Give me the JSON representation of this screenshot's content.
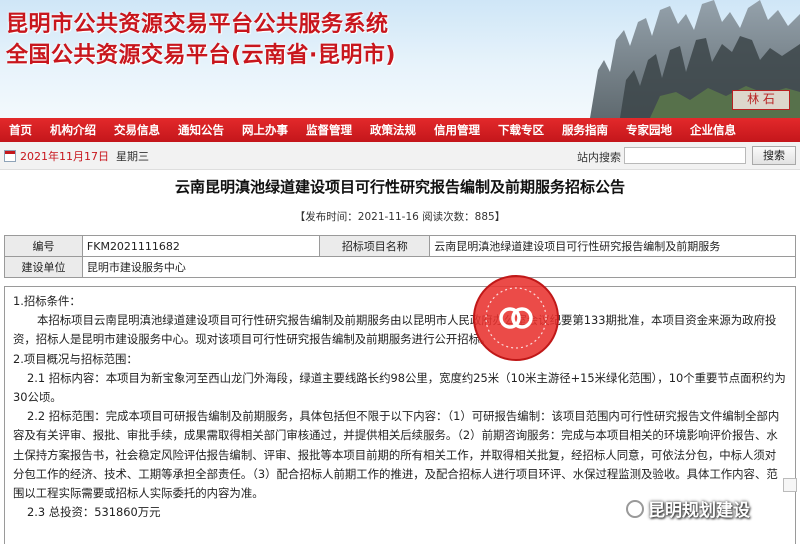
{
  "banner": {
    "title1": "昆明市公共资源交易平台公共服务系统",
    "title2": "全国公共资源交易平台(云南省·昆明市)",
    "stamp": "林 石"
  },
  "nav": {
    "items": [
      "首页",
      "机构介绍",
      "交易信息",
      "通知公告",
      "网上办事",
      "监督管理",
      "政策法规",
      "信用管理",
      "下载专区",
      "服务指南",
      "专家园地",
      "企业信息"
    ]
  },
  "infobar": {
    "date": "2021年11月17日",
    "weekday": "星期三",
    "search_label": "站内搜索",
    "search_placeholder": "",
    "search_button": "搜索"
  },
  "notice": {
    "title": "云南昆明滇池绿道建设项目可行性研究报告编制及前期服务招标公告",
    "meta": "【发布时间：2021-11-16 阅读次数：885】"
  },
  "info_table": {
    "code_label": "编号",
    "code_value": "FKM2021111682",
    "project_label": "招标项目名称",
    "project_value": "云南昆明滇池绿道建设项目可行性研究报告编制及前期服务",
    "unit_label": "建设单位",
    "unit_value": "昆明市建设服务中心"
  },
  "body": {
    "s1_head": "1.招标条件：",
    "s1_text": "本招标项目云南昆明滇池绿道建设项目可行性研究报告编制及前期服务由以昆明市人民政府办公室会议纪要第133期批准，本项目资金来源为政府投资，招标人是昆明市建设服务中心。现对该项目可行性研究报告编制及前期服务进行公开招标。",
    "s2_head": "2.项目概况与招标范围：",
    "s21": "2.1 招标内容：本项目为新宝象河至西山龙门外海段，绿道主要线路长约98公里，宽度约25米（10米主游径+15米绿化范围），10个重要节点面积约为30公顷。",
    "s22": "2.2 招标范围：完成本项目可研报告编制及前期服务，具体包括但不限于以下内容：（1）可研报告编制：该项目范围内可行性研究报告文件编制全部内容及有关评审、报批、审批手续，成果需取得相关部门审核通过，并提供相关后续服务。（2）前期咨询服务：完成与本项目相关的环境影响评价报告、水土保持方案报告书，社会稳定风险评估报告编制、评审、报批等本项目前期的所有相关工作，并取得相关批复，经招标人同意，可依法分包，中标人须对分包工作的经济、技术、工期等承担全部责任。（3）配合招标人前期工作的推进，及配合招标人进行项目环评、水保过程监测及验收。具体工作内容、范围以工程实际需要或招标人实际委托的内容为准。",
    "s23": "2.3 总投资：531860万元"
  },
  "watermark": {
    "text": "昆明规划建设"
  },
  "colors": {
    "brand_red": "#c4161b",
    "title_red": "#c8161d"
  }
}
